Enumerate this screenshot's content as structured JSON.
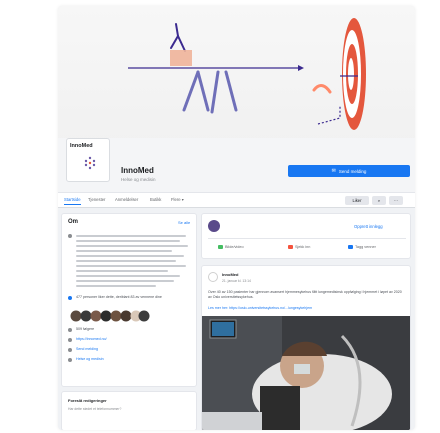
{
  "page": {
    "brand_small": "InnoMed",
    "name": "InnoMed",
    "subtitle": "Helse og medisin",
    "send_button": "Send melding",
    "send_icon": "messenger-icon"
  },
  "tabs": [
    {
      "label": "Startside",
      "active": true
    },
    {
      "label": "Tjenester",
      "active": false
    },
    {
      "label": "Anmeldelser",
      "active": false
    },
    {
      "label": "Butikk",
      "active": false
    },
    {
      "label": "Flere ▾",
      "active": false
    }
  ],
  "tab_actions": {
    "like": "Liker",
    "search_icon": "search-icon",
    "more_icon": "more-icon"
  },
  "about": {
    "title": "Om",
    "see_all": "Se alle",
    "stats": [
      "477 personer liker dette, deriblant 83 av vennene dine",
      "509 følgere"
    ],
    "contacts": [
      "https://innomed.no/",
      "Send melding",
      "Helse og medisin"
    ]
  },
  "suggested": {
    "title": "Foreslå redigeringer",
    "subtitle": "Har dette stedet et telefonnummer?"
  },
  "composer": {
    "create_post": "Opprett innlegg",
    "actions": [
      "Bilde/video",
      "Sjekk inn",
      "Tagg venner"
    ]
  },
  "post": {
    "author": "InnoMed",
    "date": "21. januar kl. 13:14",
    "body": "Over 40 av 150 pasienter har gjennom avansert hjemmesykehus fått lungemedisinsk oppfølging i hjemmet i løpet av 2020 av Oslo universitetssykehus.",
    "link": "Les mer her: https://oslo-universitetssykehus.no/...lungesykehjem"
  },
  "colors": {
    "accent": "#1877f2",
    "target_red": "#e4573d"
  }
}
